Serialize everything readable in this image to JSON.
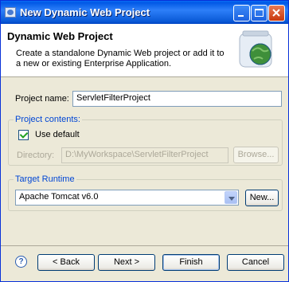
{
  "window": {
    "title": "New Dynamic Web Project"
  },
  "header": {
    "title": "Dynamic Web Project",
    "description": "Create a standalone Dynamic Web project or add it to a new or existing Enterprise Application."
  },
  "project_name": {
    "label": "Project name:",
    "value": "ServletFilterProject"
  },
  "contents": {
    "group_label": "Project contents:",
    "use_default_label": "Use default",
    "use_default_checked": true,
    "directory_label": "Directory:",
    "directory_value": "D:\\MyWorkspace\\ServletFilterProject",
    "browse_label": "Browse..."
  },
  "runtime": {
    "group_label": "Target Runtime",
    "selected": "Apache Tomcat v6.0",
    "new_label": "New..."
  },
  "footer": {
    "help_glyph": "?",
    "back_label": "< Back",
    "next_label": "Next >",
    "finish_label": "Finish",
    "cancel_label": "Cancel"
  },
  "colors": {
    "title_bar": "#0058e6",
    "group_label": "#0046d5",
    "dialog_bg": "#ece9d8",
    "check": "#21a121"
  }
}
